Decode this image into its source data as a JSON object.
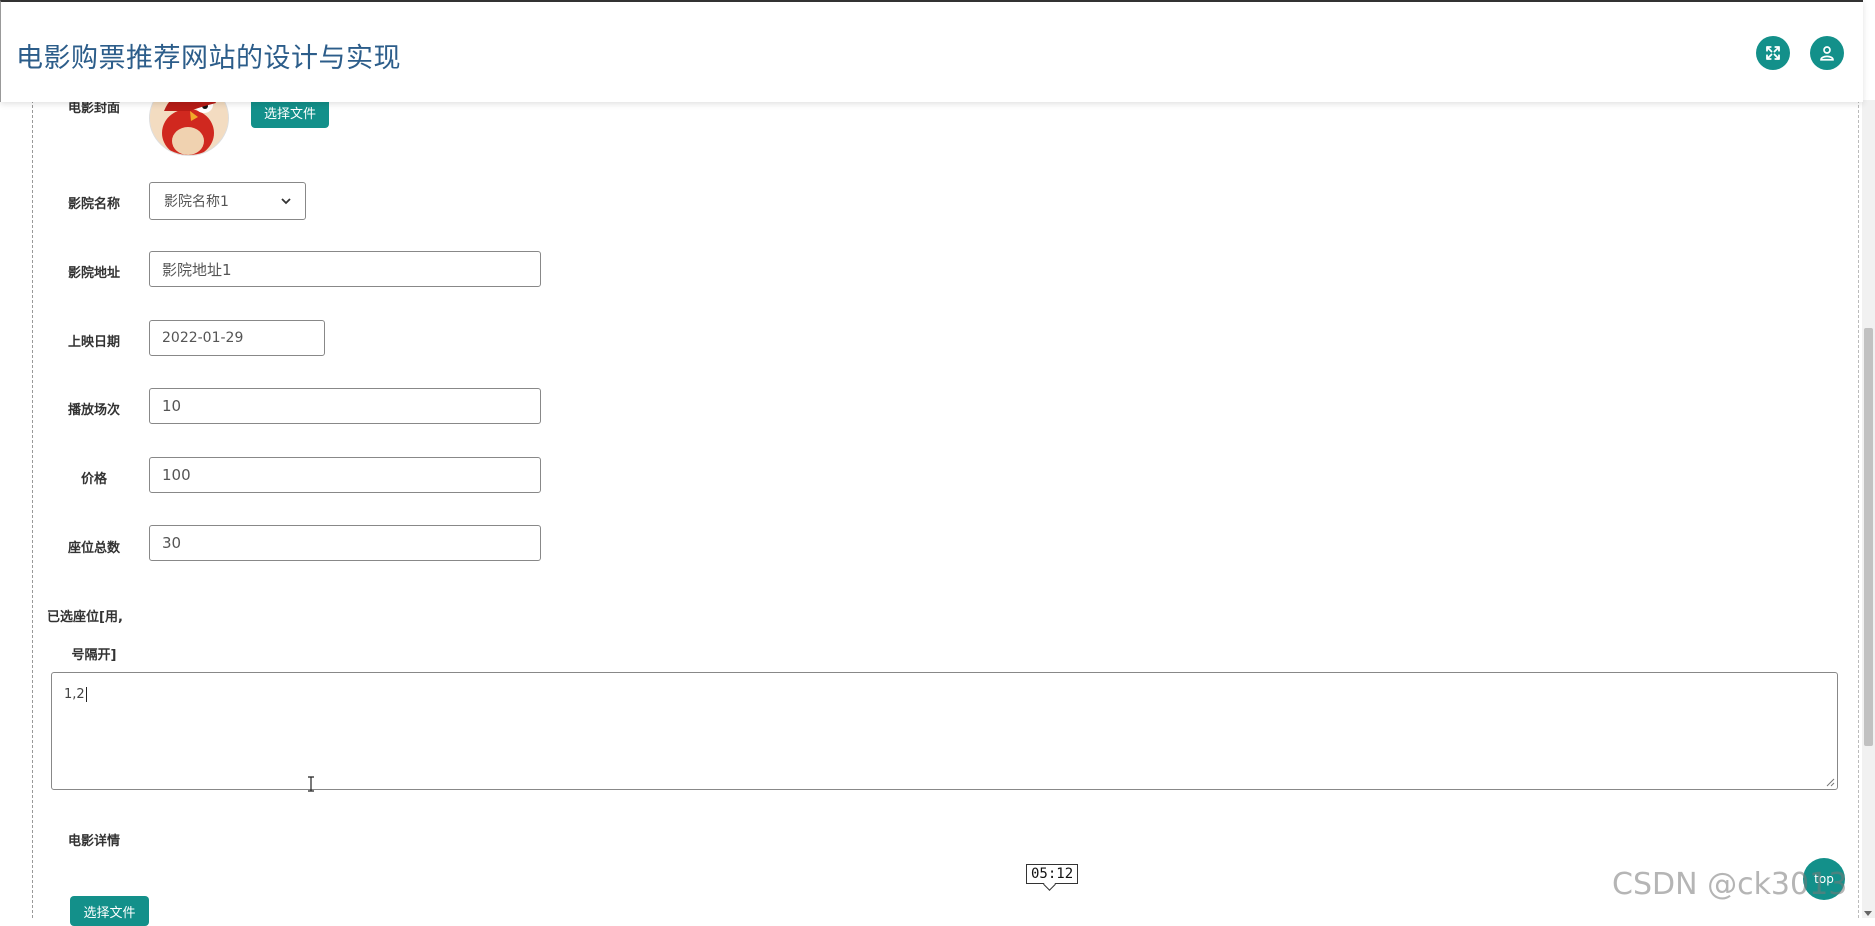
{
  "header": {
    "title": "电影购票推荐网站的设计与实现",
    "fullscreen_icon": "expand-icon",
    "user_icon": "user-icon",
    "accent_color": "#13908a"
  },
  "form": {
    "cover": {
      "label": "电影封面",
      "button": "选择文件"
    },
    "cinema_name": {
      "label": "影院名称",
      "value": "影院名称1"
    },
    "cinema_address": {
      "label": "影院地址",
      "value": "影院地址1"
    },
    "release_date": {
      "label": "上映日期",
      "value": "2022-01-29"
    },
    "showings": {
      "label": "播放场次",
      "value": "10"
    },
    "price": {
      "label": "价格",
      "value": "100"
    },
    "total_seats": {
      "label": "座位总数",
      "value": "30"
    },
    "selected_seats": {
      "label_line1": "已选座位[用,",
      "label_line2": "号隔开]",
      "value": "1,2"
    },
    "details": {
      "label": "电影详情",
      "button": "选择文件"
    }
  },
  "overlay": {
    "time_tooltip": "05:12",
    "top_button": "top",
    "watermark": "CSDN @ck3013"
  }
}
